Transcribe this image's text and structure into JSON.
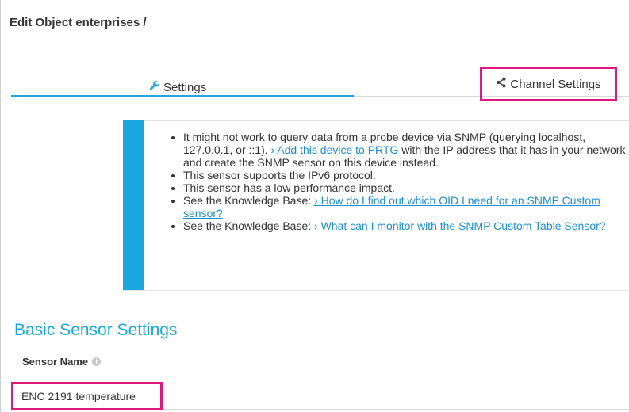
{
  "header": {
    "title": "Edit Object enterprises /"
  },
  "tabs": {
    "settings": {
      "label": "Settings",
      "icon": "wrench-icon"
    },
    "channel_settings": {
      "label": "Channel Settings",
      "icon": "share-icon"
    }
  },
  "info": {
    "items": [
      {
        "text": "It might not work to query data from a probe device via SNMP (querying localhost, 127.0.0.1, or ::1). ",
        "link": "Add this device to PRTG",
        "suffix": " with the IP address that it has in your network and create the SNMP sensor on this device instead."
      },
      {
        "text": "This sensor supports the IPv6 protocol."
      },
      {
        "text": "This sensor has a low performance impact."
      },
      {
        "text": "See the Knowledge Base: ",
        "link": "How do I find out which OID I need for an SNMP Custom sensor?"
      },
      {
        "text": "See the Knowledge Base: ",
        "link": "What can I monitor with the SNMP Custom Table Sensor?"
      }
    ],
    "link_prefix": "›"
  },
  "basic_settings": {
    "title": "Basic Sensor Settings",
    "sensor_name_label": "Sensor Name",
    "sensor_name_value": "ENC 2191 temperature"
  },
  "colors": {
    "accent": "#1aa6df",
    "highlight": "#e0187b",
    "link": "#1a8fd4"
  }
}
